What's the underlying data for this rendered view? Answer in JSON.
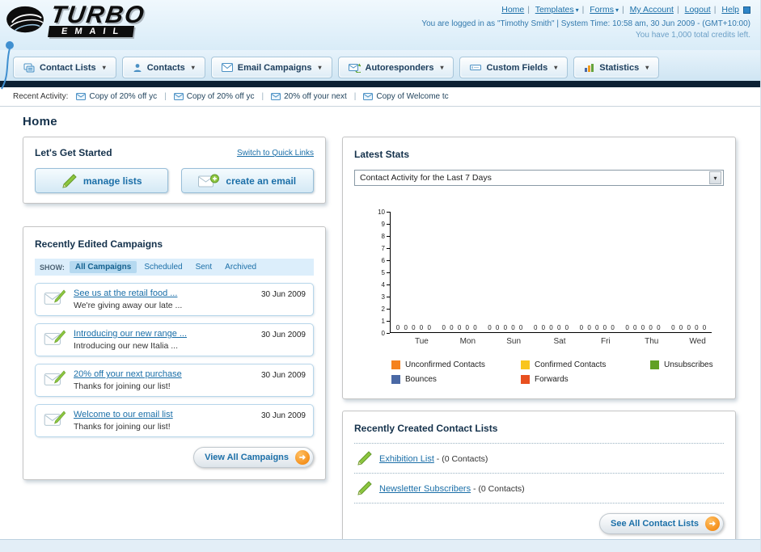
{
  "icons": {
    "caret": "▾",
    "separator": "|",
    "arrow": "➜"
  },
  "header": {
    "logo": {
      "line1": "TURBO",
      "line2": "EMAIL"
    },
    "top_links": [
      {
        "label": "Home"
      },
      {
        "label": "Templates"
      },
      {
        "label": "Forms"
      },
      {
        "label": "My Account"
      },
      {
        "label": "Logout"
      },
      {
        "label": "Help"
      }
    ],
    "login_line": "You are logged in as \"Timothy Smith\" | System Time: 10:58 am, 30 Jun 2009 - (GMT+10:00)",
    "credits_line": "You have 1,000 total credits left."
  },
  "nav": {
    "tabs": [
      {
        "label": "Contact Lists"
      },
      {
        "label": "Contacts"
      },
      {
        "label": "Email Campaigns"
      },
      {
        "label": "Autoresponders"
      },
      {
        "label": "Custom Fields"
      },
      {
        "label": "Statistics"
      }
    ]
  },
  "recent_activity": {
    "label": "Recent Activity:",
    "items": [
      "Copy of 20% off yc",
      "Copy of 20% off yc",
      "20% off your next",
      "Copy of Welcome tc"
    ]
  },
  "page_title": "Home",
  "get_started": {
    "title": "Let's Get Started",
    "switch_link": "Switch to Quick Links",
    "manage_lists_label": "manage lists",
    "create_email_label": "create an email"
  },
  "campaigns": {
    "title": "Recently Edited Campaigns",
    "show_label": "SHOW:",
    "filters": [
      "All Campaigns",
      "Scheduled",
      "Sent",
      "Archived"
    ],
    "items": [
      {
        "title": "See us at the retail food ...",
        "subtitle": "We're giving away our late ...",
        "date": "30 Jun 2009"
      },
      {
        "title": "Introducing our new range ...",
        "subtitle": "Introducing our new Italia ...",
        "date": "30 Jun 2009"
      },
      {
        "title": "20% off your next purchase",
        "subtitle": "Thanks for joining our list!",
        "date": "30 Jun 2009"
      },
      {
        "title": "Welcome to our email list",
        "subtitle": "Thanks for joining our list!",
        "date": "30 Jun 2009"
      }
    ],
    "view_all_label": "View All Campaigns"
  },
  "stats": {
    "title": "Latest Stats",
    "dropdown_value": "Contact Activity for the Last 7 Days",
    "legend": [
      {
        "label": "Unconfirmed Contacts",
        "color": "#f5821f"
      },
      {
        "label": "Confirmed Contacts",
        "color": "#f9c51d"
      },
      {
        "label": "Unsubscribes",
        "color": "#61a024"
      },
      {
        "label": "Bounces",
        "color": "#4a69a5"
      },
      {
        "label": "Forwards",
        "color": "#e8501f"
      }
    ]
  },
  "chart_data": {
    "type": "bar",
    "title": "Contact Activity for the Last 7 Days",
    "categories": [
      "Tue",
      "Mon",
      "Sun",
      "Sat",
      "Fri",
      "Thu",
      "Wed"
    ],
    "series": [
      {
        "name": "Unconfirmed Contacts",
        "values": [
          0,
          0,
          0,
          0,
          0,
          0,
          0
        ]
      },
      {
        "name": "Confirmed Contacts",
        "values": [
          0,
          0,
          0,
          0,
          0,
          0,
          0
        ]
      },
      {
        "name": "Unsubscribes",
        "values": [
          0,
          0,
          0,
          0,
          0,
          0,
          0
        ]
      },
      {
        "name": "Bounces",
        "values": [
          0,
          0,
          0,
          0,
          0,
          0,
          0
        ]
      },
      {
        "name": "Forwards",
        "values": [
          0,
          0,
          0,
          0,
          0,
          0,
          0
        ]
      }
    ],
    "ylim": [
      0,
      10
    ],
    "yticks": [
      0,
      1,
      2,
      3,
      4,
      5,
      6,
      7,
      8,
      9,
      10
    ],
    "xlabel": "",
    "ylabel": "",
    "legend_position": "bottom",
    "grid": false
  },
  "contact_lists": {
    "title": "Recently Created Contact Lists",
    "items": [
      {
        "name": "Exhibition List",
        "suffix": " - (0 Contacts)"
      },
      {
        "name": "Newsletter Subscribers",
        "suffix": " - (0 Contacts)"
      }
    ],
    "see_all_label": "See All Contact Lists"
  }
}
